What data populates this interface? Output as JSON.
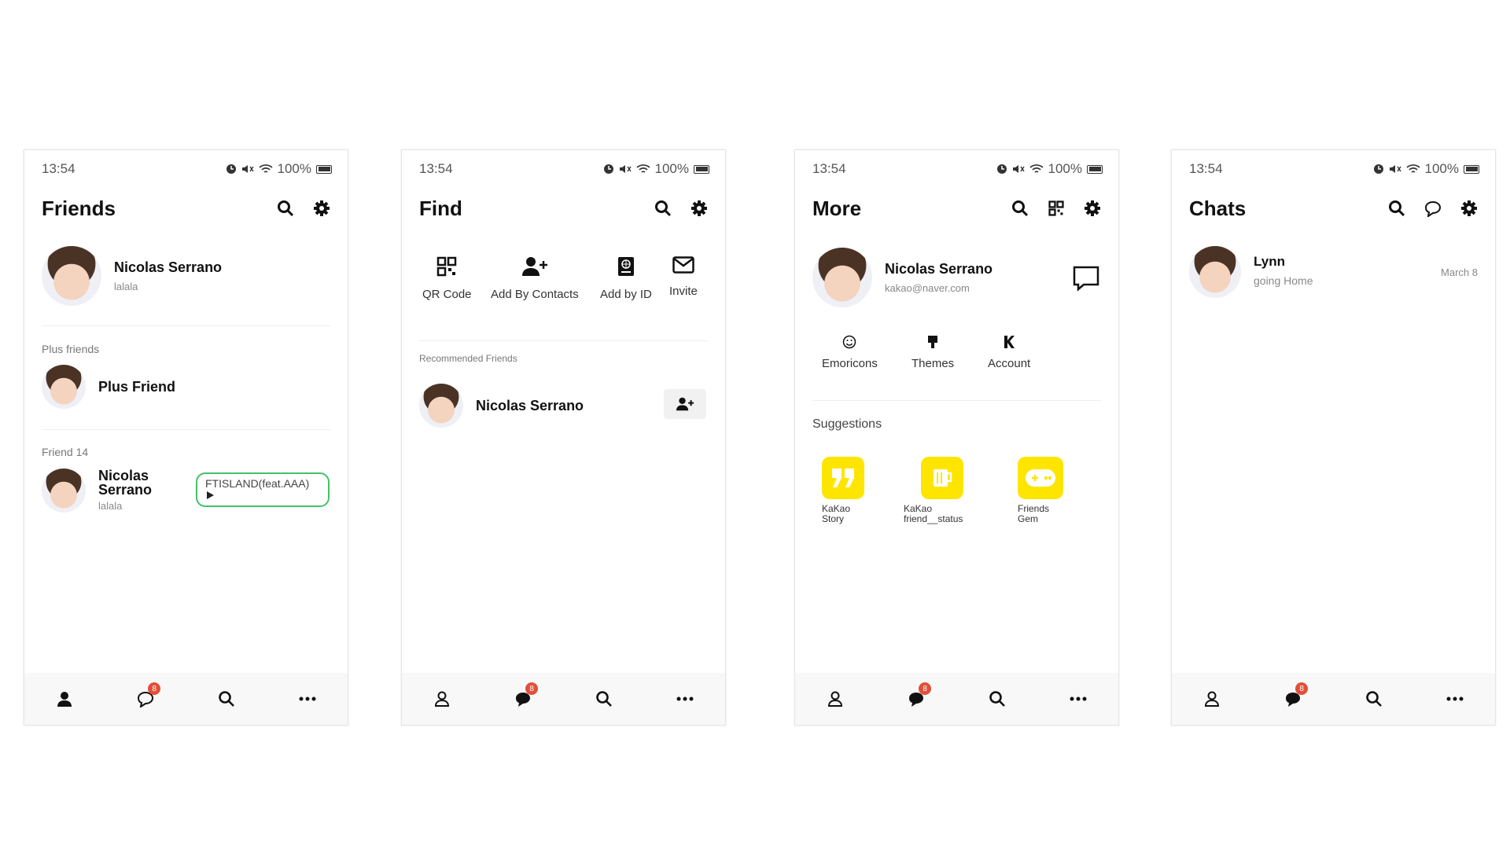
{
  "status": {
    "time": "13:54",
    "battery": "100%"
  },
  "friends": {
    "title": "Friends",
    "profile": {
      "name": "Nicolas Serrano",
      "status": "lalala"
    },
    "plus_label": "Plus friends",
    "plus_friend": "Plus Friend",
    "friend_count_label": "Friend 14",
    "friend": {
      "name": "Nicolas Serrano",
      "status": "lalala",
      "music": "FTISLAND(feat.AAA)"
    }
  },
  "find": {
    "title": "Find",
    "options": [
      {
        "label": "QR Code",
        "icon": "qr-icon"
      },
      {
        "label": "Add By Contacts",
        "icon": "add-user-icon"
      },
      {
        "label": "Add by ID",
        "icon": "id-card-icon"
      },
      {
        "label": "Invite",
        "icon": "mail-icon"
      }
    ],
    "recommended_label": "Recommended Friends",
    "recommended": {
      "name": "Nicolas Serrano"
    }
  },
  "more": {
    "title": "More",
    "profile": {
      "name": "Nicolas Serrano",
      "email": "kakao@naver.com"
    },
    "options": [
      {
        "label": "Emoricons",
        "icon": "smile-icon"
      },
      {
        "label": "Themes",
        "icon": "brush-icon"
      },
      {
        "label": "Account",
        "icon": "k-icon"
      }
    ],
    "suggestions_label": "Suggestions",
    "suggestions": [
      {
        "label_1": "KaKao",
        "label_2": "Story",
        "icon": "quote-icon"
      },
      {
        "label_1": "KaKao",
        "label_2": "friend__status",
        "icon": "mug-icon"
      },
      {
        "label_1": "Friends",
        "label_2": "Gem",
        "icon": "gamepad-icon"
      }
    ]
  },
  "chats": {
    "title": "Chats",
    "item": {
      "name": "Lynn",
      "preview": "going Home",
      "date": "March 8"
    }
  },
  "tabbar": {
    "badge": "8"
  },
  "colors": {
    "accent_yellow": "#fee500",
    "badge_red": "#e0503a",
    "music_border": "#45c06a"
  }
}
